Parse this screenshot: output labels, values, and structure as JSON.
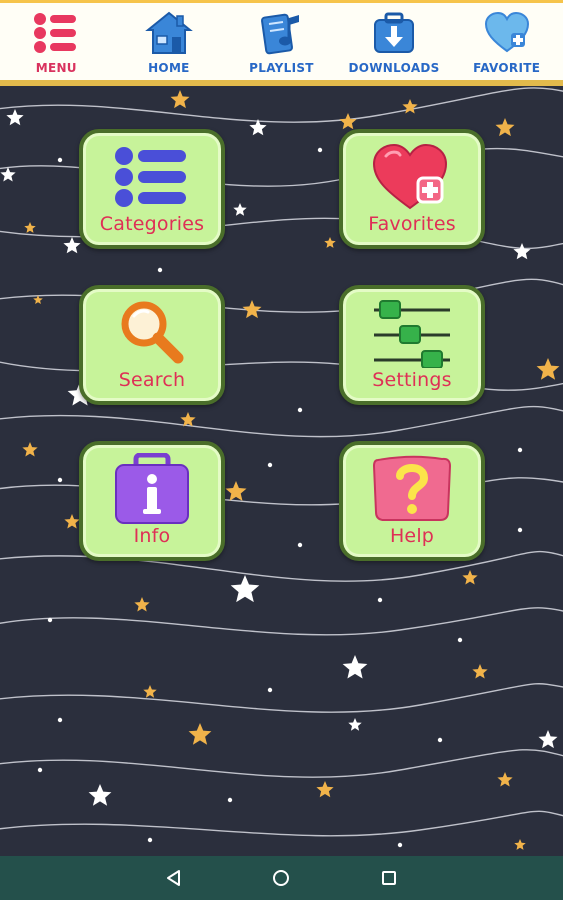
{
  "top_nav": [
    {
      "label": "MENU",
      "icon": "list-icon"
    },
    {
      "label": "HOME",
      "icon": "house-icon"
    },
    {
      "label": "PLAYLIST",
      "icon": "music-note-icon"
    },
    {
      "label": "DOWNLOADS",
      "icon": "download-icon"
    },
    {
      "label": "FAVORITE",
      "icon": "heart-plus-icon"
    }
  ],
  "tiles": {
    "categories": {
      "label": "Categories",
      "icon": "bullet-list-icon"
    },
    "favorites": {
      "label": "Favorites",
      "icon": "heart-plus-icon"
    },
    "search": {
      "label": "Search",
      "icon": "magnifier-icon"
    },
    "settings": {
      "label": "Settings",
      "icon": "sliders-icon"
    },
    "info": {
      "label": "Info",
      "icon": "info-briefcase-icon"
    },
    "help": {
      "label": "Help",
      "icon": "question-mark-icon"
    }
  },
  "system_nav": [
    {
      "icon": "back-triangle-icon"
    },
    {
      "icon": "home-circle-icon"
    },
    {
      "icon": "recents-square-icon"
    }
  ],
  "colors": {
    "background": "#2b2f3d",
    "tile_fill": "#c7f39a",
    "tile_border": "#4a6e2a",
    "label_red": "#df2f56",
    "nav_blue": "#2868c6",
    "nav_pink": "#d9325e",
    "star_gold": "#f1b34a",
    "system_bar": "#24504b"
  }
}
